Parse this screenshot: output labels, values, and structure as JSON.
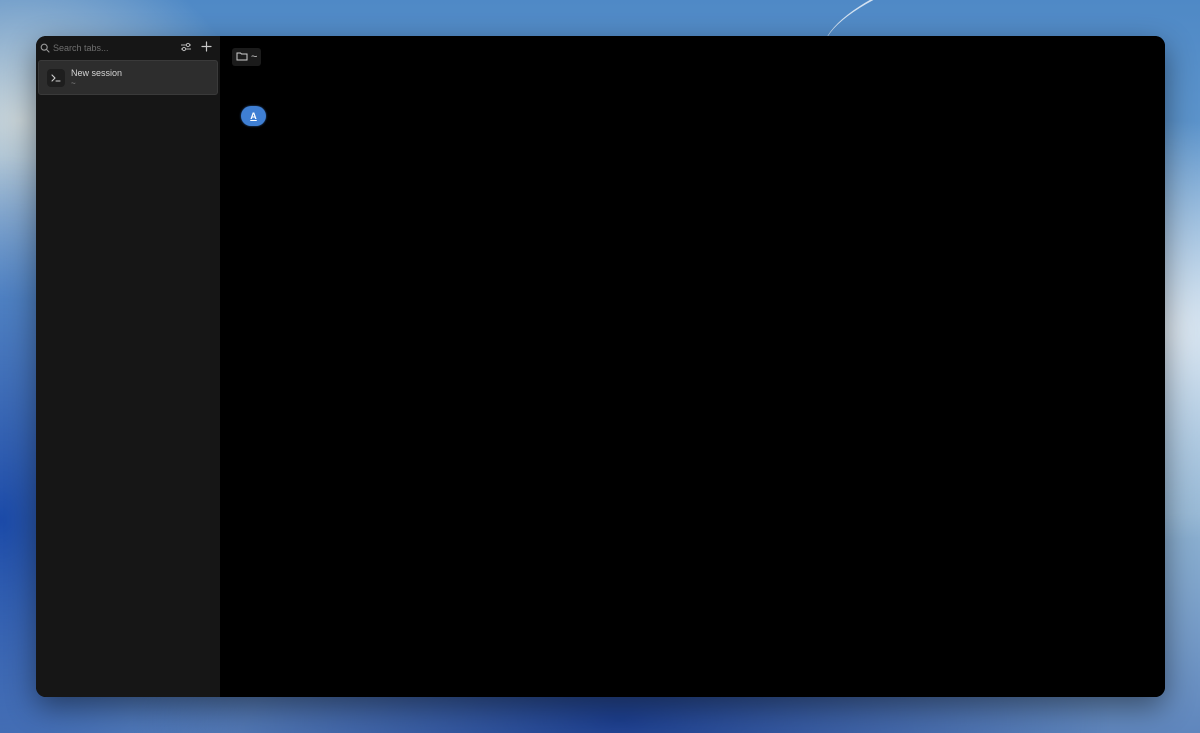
{
  "sidebar": {
    "search": {
      "placeholder": "Search tabs..."
    },
    "sessions": [
      {
        "title": "New session",
        "subtitle": "~"
      }
    ]
  },
  "main": {
    "directory": {
      "label": "~"
    },
    "agent_badge": {
      "label": "A"
    }
  },
  "icons": {
    "search": "search-icon",
    "filter": "sliders-icon",
    "add": "plus-icon",
    "terminal": "terminal-icon",
    "folder": "folder-icon"
  },
  "colors": {
    "window_bg": "#000000",
    "sidebar_bg": "#161616",
    "session_selected_bg": "#2d2d2d",
    "accent": "#3f7fd3"
  }
}
